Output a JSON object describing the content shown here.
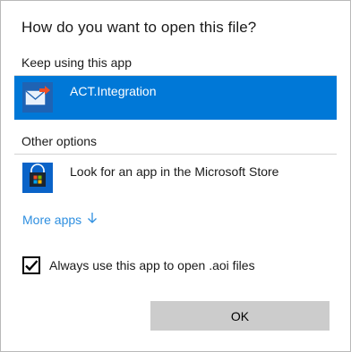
{
  "dialog": {
    "title": "How do you want to open this file?"
  },
  "keep_using": {
    "label": "Keep using this app",
    "app": {
      "name": "ACT.Integration",
      "icon": "mail-arrow-icon"
    }
  },
  "other_options": {
    "label": "Other options",
    "items": [
      {
        "name": "Look for an app in the Microsoft Store",
        "icon": "microsoft-store-icon"
      }
    ]
  },
  "more_apps": {
    "label": "More apps",
    "icon": "arrow-down-icon"
  },
  "always_use": {
    "label": "Always use this app to open .aoi files",
    "checked": true
  },
  "ok_button": {
    "label": "OK"
  },
  "colors": {
    "accent": "#0078d7",
    "link": "#2e8fe0",
    "button_bg": "#cccccc"
  }
}
